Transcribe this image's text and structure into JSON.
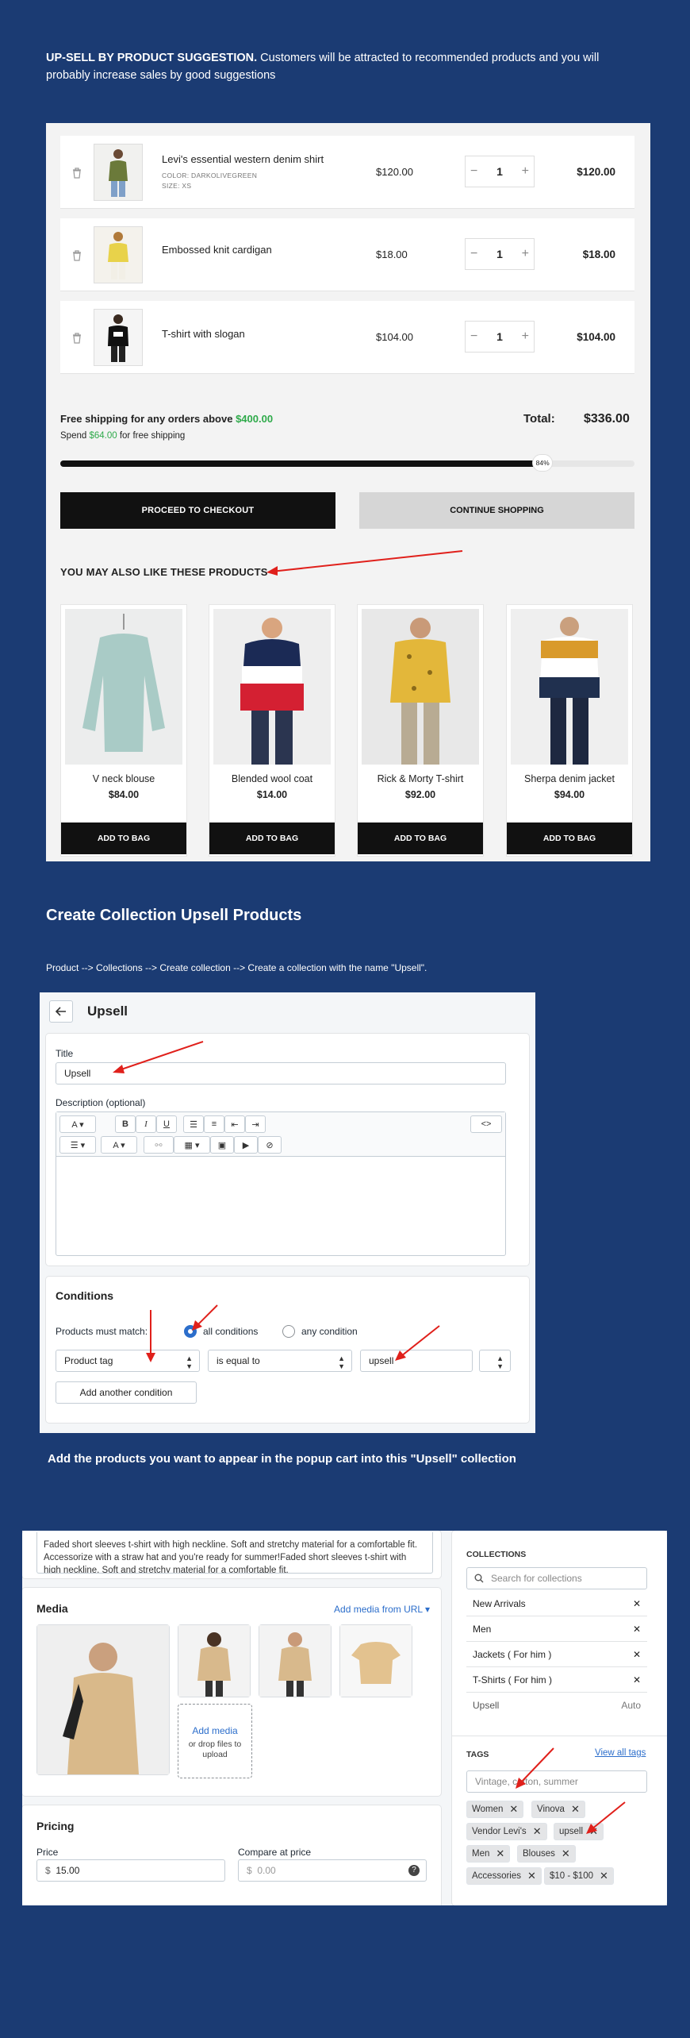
{
  "intro": {
    "bold": "UP-SELL BY PRODUCT SUGGESTION.",
    "text": " Customers will be attracted to recommended products and you will probably increase sales by good suggestions"
  },
  "cart": {
    "items": [
      {
        "name": "Levi's essential western denim shirt",
        "color": "COLOR: DARKOLIVEGREEN",
        "size": "SIZE: XS",
        "price": "$120.00",
        "qty": "1",
        "total": "$120.00"
      },
      {
        "name": "Embossed knit cardigan",
        "price": "$18.00",
        "qty": "1",
        "total": "$18.00"
      },
      {
        "name": "T-shirt with slogan",
        "price": "$104.00",
        "qty": "1",
        "total": "$104.00"
      }
    ],
    "shipping_prefix": "Free shipping for any orders above ",
    "shipping_amount": "$400.00",
    "spend_prefix": "Spend ",
    "spend_amount": "$64.00",
    "spend_suffix": " for free shipping",
    "total_label": "Total:",
    "total_value": "$336.00",
    "progress_label": "84%",
    "progress_fraction": 0.84,
    "checkout_label": "PROCEED TO CHECKOUT",
    "continue_label": "CONTINUE SHOPPING",
    "suggest_title": "YOU MAY ALSO LIKE THESE PRODUCTS",
    "products": [
      {
        "name": "V neck blouse",
        "price": "$84.00",
        "button": "ADD TO BAG"
      },
      {
        "name": "Blended wool coat",
        "price": "$14.00",
        "button": "ADD TO BAG"
      },
      {
        "name": "Rick & Morty T-shirt",
        "price": "$92.00",
        "button": "ADD TO BAG"
      },
      {
        "name": "Sherpa denim jacket",
        "price": "$94.00",
        "button": "ADD TO BAG"
      }
    ]
  },
  "section2": {
    "heading": "Create Collection Upsell Products",
    "path": "Product --> Collections --> Create collection --> Create a collection with the name \"Upsell\".",
    "page_title": "Upsell",
    "title_label": "Title",
    "title_value": "Upsell",
    "desc_label": "Description (optional)",
    "source_label": "<>",
    "conditions_title": "Conditions",
    "match_label": "Products must match:",
    "all_label": "all conditions",
    "any_label": "any condition",
    "cond_field": "Product tag",
    "cond_op": "is equal to",
    "cond_value": "upsell",
    "add_condition": "Add another condition"
  },
  "section3": {
    "heading": "Add the products you want to appear in the popup cart into this \"Upsell\" collection",
    "description": "Faded short sleeves t-shirt with high neckline. Soft and stretchy material for a comfortable fit. Accessorize with a straw hat and you're ready for summer!Faded short sleeves t-shirt with high neckline. Soft and stretchy material for a comfortable fit.",
    "media_title": "Media",
    "add_media_url": "Add media from URL",
    "add_media": "Add media",
    "drop_files": "or drop files to upload",
    "pricing_title": "Pricing",
    "price_label": "Price",
    "price_value": "15.00",
    "compare_label": "Compare at price",
    "compare_value": "0.00",
    "currency": "$",
    "collections_title": "COLLECTIONS",
    "search_placeholder": "Search for collections",
    "collections": [
      {
        "name": "New Arrivals",
        "action": "✕"
      },
      {
        "name": "Men",
        "action": "✕"
      },
      {
        "name": "Jackets ( For him )",
        "action": "✕"
      },
      {
        "name": "T-Shirts ( For him )",
        "action": "✕"
      },
      {
        "name": "Upsell",
        "action": "Auto"
      }
    ],
    "tags_title": "TAGS",
    "view_all_tags": "View all tags",
    "tags_placeholder": "Vintage, cotton, summer",
    "tags": [
      "Women",
      "Vinova",
      "Vendor Levi's",
      "upsell",
      "Men",
      "Blouses",
      "Accessories",
      "$10 - $100"
    ]
  },
  "colors": {
    "background": "#1b3b73",
    "accent_green": "#2eaa4a",
    "shopify_blue": "#2c6ecb",
    "arrow_red": "#e0201b"
  }
}
